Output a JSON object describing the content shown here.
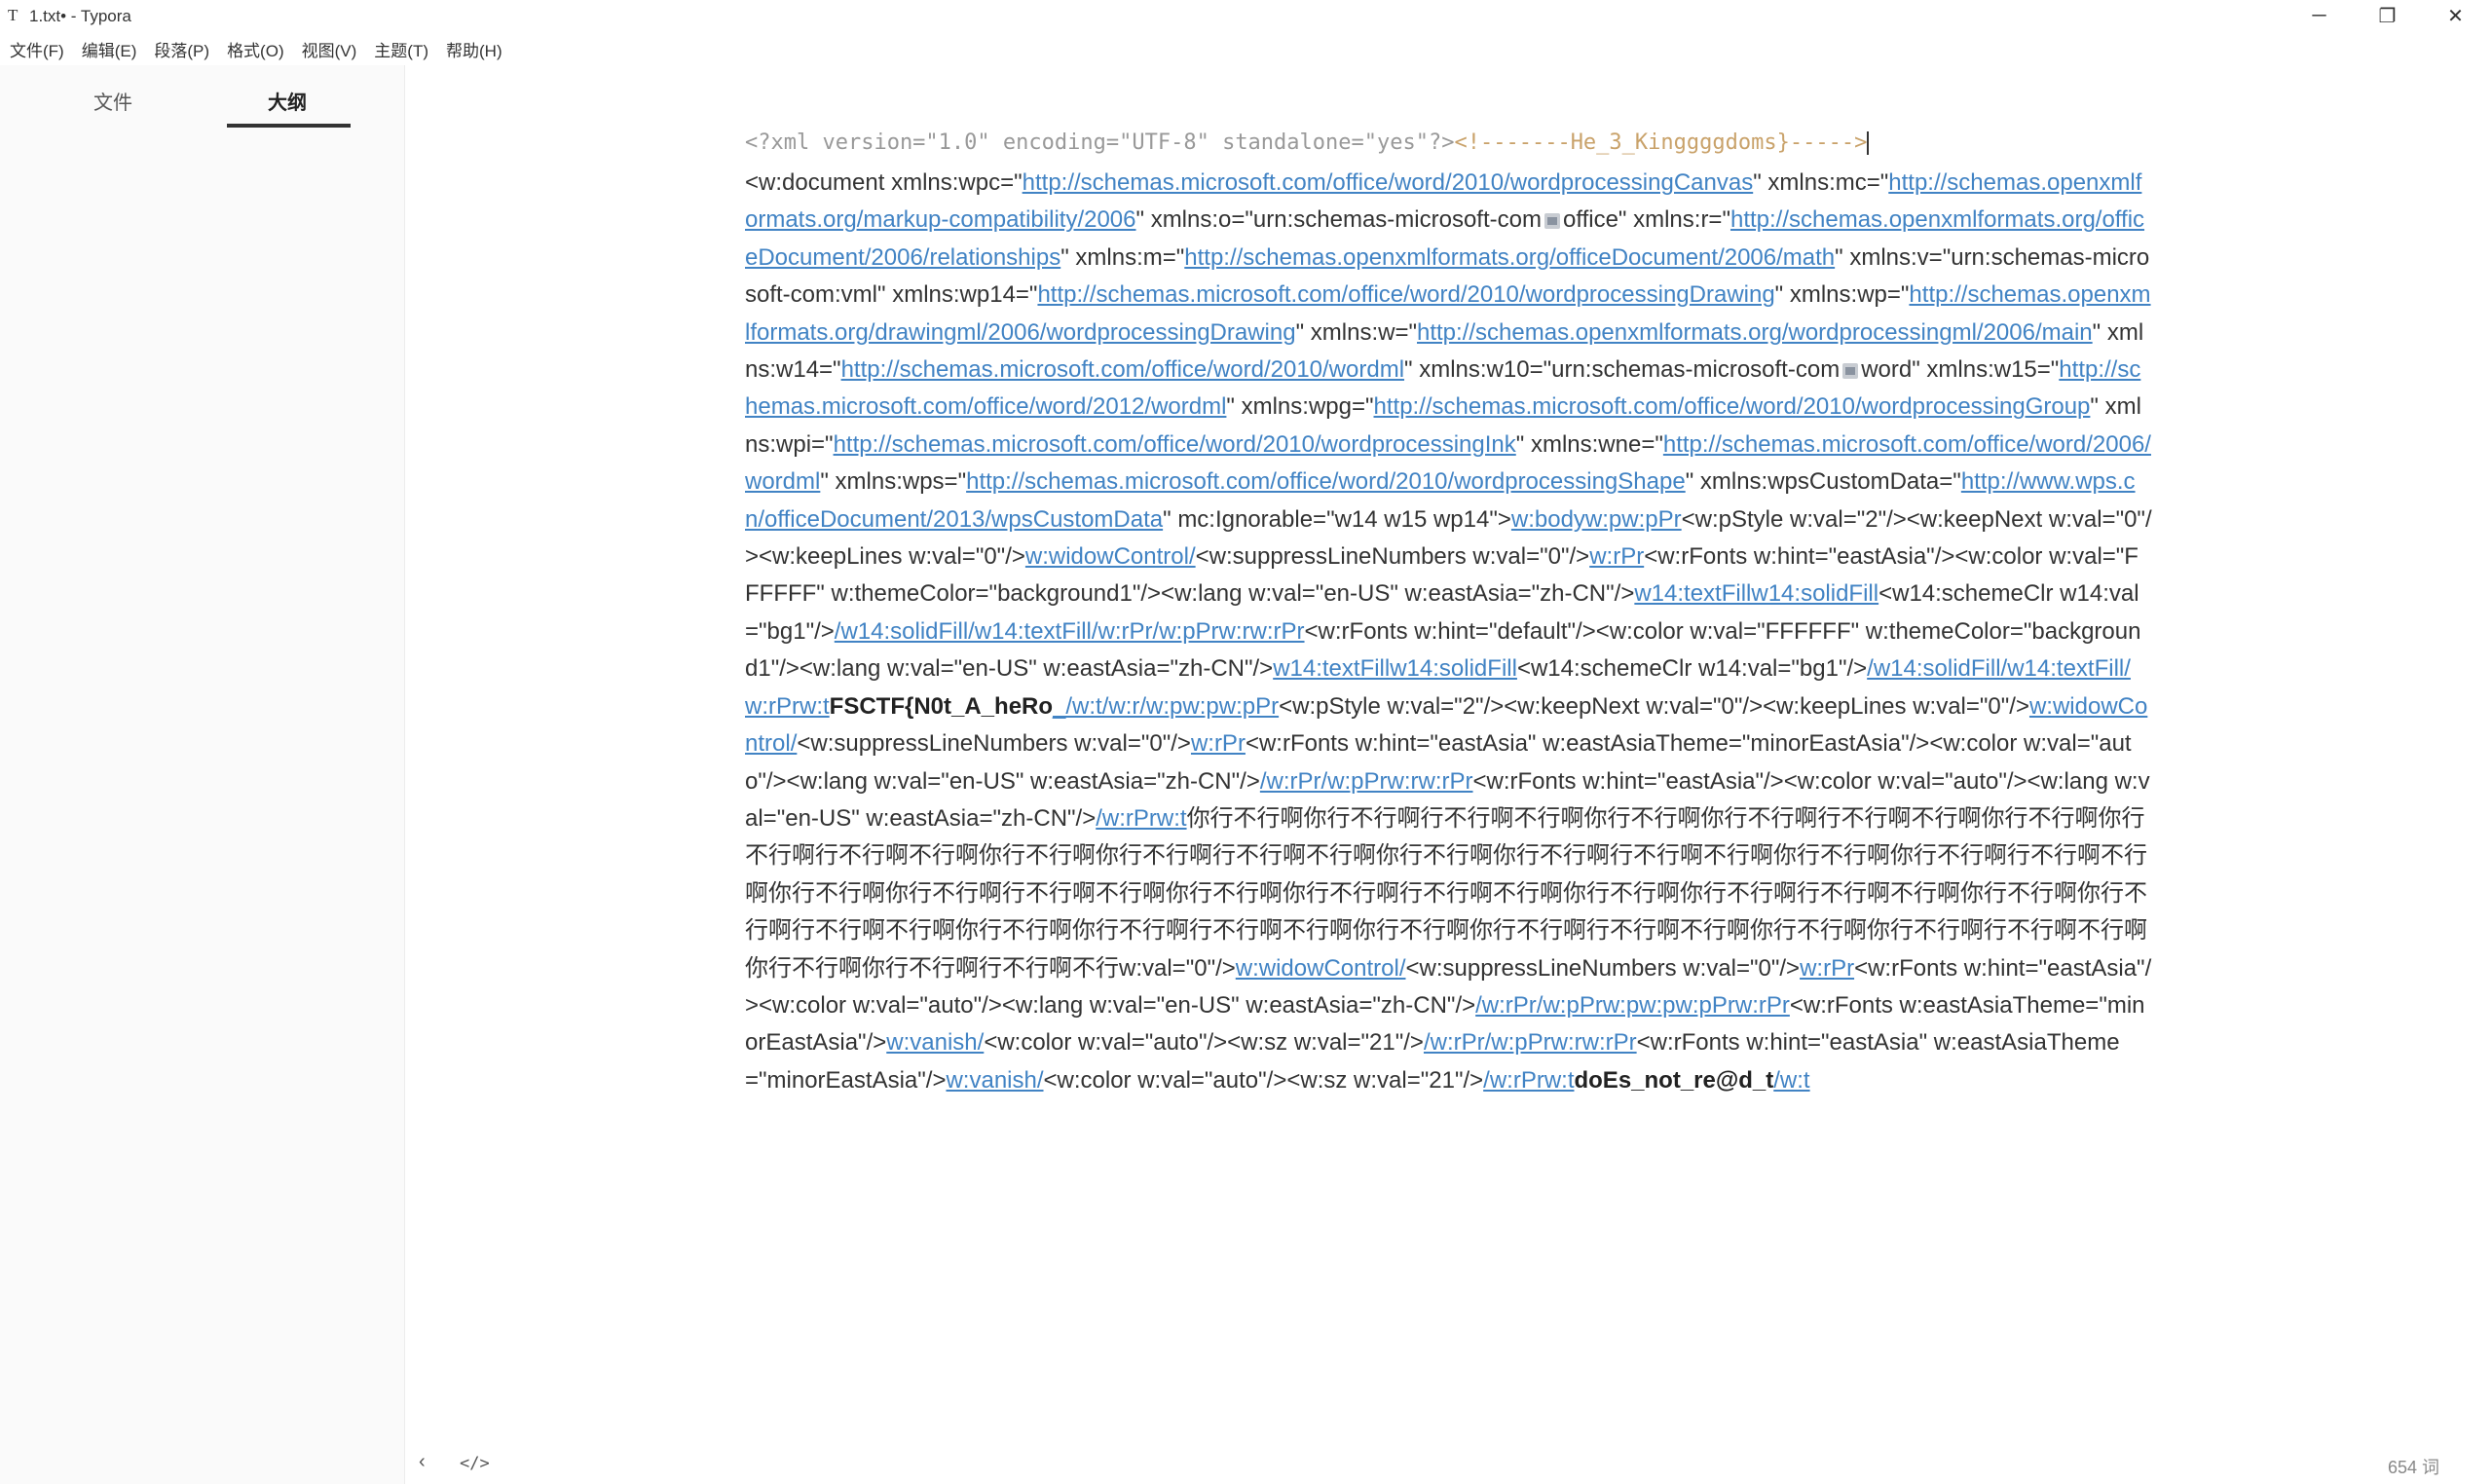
{
  "window": {
    "app_icon": "T",
    "title": "1.txt• - Typora",
    "minimize": "─",
    "maximize": "❐",
    "close": "✕"
  },
  "menu": [
    "文件(F)",
    "编辑(E)",
    "段落(P)",
    "格式(O)",
    "视图(V)",
    "主题(T)",
    "帮助(H)"
  ],
  "sidebar": {
    "tab_files": "文件",
    "tab_outline": "大纲"
  },
  "editor": {
    "code_line_1": "<?xml version=\"1.0\" encoding=\"UTF-8\" standalone=\"yes\"?>",
    "code_line_comment": "<!-------He_3_Kinggggdoms}----->",
    "seg": [
      "<w:document xmlns:wpc=\"",
      "http://schemas.microsoft.com/office/word/2010/wordprocessingCanvas",
      "\" xmlns:mc=\"",
      "http://schemas.openxmlformats.org/markup-compatibility/2006",
      "\" xmlns:o=\"urn:schemas-microsoft-com",
      "office\" xmlns:r=\"",
      "http://schemas.openxmlformats.org/officeDocument/2006/relationships",
      "\" xmlns:m=\"",
      "http://schemas.openxmlformats.org/officeDocument/2006/math",
      "\" xmlns:v=\"urn:schemas-microsoft-com:vml\" xmlns:wp14=\"",
      "http://schemas.microsoft.com/office/word/2010/wordprocessingDrawing",
      "\" xmlns:wp=\"",
      "http://schemas.openxmlformats.org/drawingml/2006/wordprocessingDrawing",
      "\" xmlns:w=\"",
      "http://schemas.openxmlformats.org/wordprocessingml/2006/main",
      "\" xmlns:w14=\"",
      "http://schemas.microsoft.com/office/word/2010/wordml",
      "\" xmlns:w10=\"urn:schemas-microsoft-com",
      "word\" xmlns:w15=\"",
      "http://schemas.microsoft.com/office/word/2012/wordml",
      "\" xmlns:wpg=\"",
      "http://schemas.microsoft.com/office/word/2010/wordprocessingGroup",
      "\" xmlns:wpi=\"",
      "http://schemas.microsoft.com/office/word/2010/wordprocessingInk",
      "\" xmlns:wne=\"",
      "http://schemas.microsoft.com/office/word/2006/wordml",
      "\" xmlns:wps=\"",
      "http://schemas.microsoft.com/office/word/2010/wordprocessingShape",
      "\" xmlns:wpsCustomData=\"",
      "http://www.wps.cn/officeDocument/2013/wpsCustomData",
      "\" mc:Ignorable=\"w14 w15 wp14\">",
      "w:bodyw:pw:pPr",
      "<w:pStyle w:val=\"2\"/><w:keepNext w:val=\"0\"/><w:keepLines w:val=\"0\"/>",
      "w:widowControl/",
      "<w:suppressLineNumbers w:val=\"0\"/>",
      "w:rPr",
      "<w:rFonts w:hint=\"eastAsia\"/><w:color w:val=\"FFFFFF\" w:themeColor=\"background1\"/><w:lang w:val=\"en-US\" w:eastAsia=\"zh-CN\"/>",
      "w14:textFillw14:solidFill",
      "<w14:schemeClr w14:val=\"bg1\"/>",
      "/w14:solidFill/w14:textFill/w:rPr/w:pPrw:rw:rPr",
      "<w:rFonts w:hint=\"default\"/><w:color w:val=\"FFFFFF\" w:themeColor=\"background1\"/><w:lang w:val=\"en-US\" w:eastAsia=\"zh-CN\"/>",
      "w14:textFillw14:solidFill",
      "<w14:schemeClr w14:val=\"bg1\"/>",
      "/w14:solidFill/w14:textFill/w:rPrw:t",
      "FSCTF{N0t_A_heRo",
      "_/w:t/w:r/w:pw:pw:pPr",
      "<w:pStyle w:val=\"2\"/><w:keepNext w:val=\"0\"/><w:keepLines w:val=\"0\"/>",
      "w:widowControl/",
      "<w:suppressLineNumbers w:val=\"0\"/>",
      "w:rPr",
      "<w:rFonts w:hint=\"eastAsia\" w:eastAsiaTheme=\"minorEastAsia\"/><w:color w:val=\"auto\"/><w:lang w:val=\"en-US\" w:eastAsia=\"zh-CN\"/>",
      "/w:rPr/w:pPrw:rw:rPr",
      "<w:rFonts w:hint=\"eastAsia\"/><w:color w:val=\"auto\"/><w:lang w:val=\"en-US\" w:eastAsia=\"zh-CN\"/>",
      "/w:rPrw:t",
      "你行不行啊你行不行啊行不行啊不行啊你行不行啊你行不行啊行不行啊不行啊你行不行啊你行不行啊行不行啊不行啊你行不行啊你行不行啊行不行啊不行啊你行不行啊你行不行啊行不行啊不行啊你行不行啊你行不行啊行不行啊不行啊你行不行啊你行不行啊行不行啊不行啊你行不行啊你行不行啊行不行啊不行啊你行不行啊你行不行啊行不行啊不行啊你行不行啊你行不行啊行不行啊不行啊你行不行啊你行不行啊行不行啊不行啊你行不行啊你行不行啊行不行啊不行啊你行不行啊你行不行啊行不行啊不行啊你行不行啊你行不行啊行不行啊不行",
      "w:val=\"0\"/>",
      "w:widowControl/",
      "<w:suppressLineNumbers w:val=\"0\"/>",
      "w:rPr",
      "<w:rFonts w:hint=\"eastAsia\"/><w:color w:val=\"auto\"/><w:lang w:val=\"en-US\" w:eastAsia=\"zh-CN\"/>",
      "/w:rPr/w:pPrw:pw:pw:pPrw:rPr",
      "<w:rFonts w:eastAsiaTheme=\"minorEastAsia\"/>",
      "w:vanish/",
      "<w:color w:val=\"auto\"/><w:sz w:val=\"21\"/>",
      "/w:rPr/w:pPrw:rw:rPr",
      "<w:rFonts w:hint=\"eastAsia\" w:eastAsiaTheme=\"minorEastAsia\"/>",
      "w:vanish/",
      "<w:color w:val=\"auto\"/><w:sz w:val=\"21\"/>",
      "/w:rPrw:t",
      "doEs_not_re@d_t",
      "/w:t"
    ]
  },
  "status": {
    "back": "‹",
    "source_toggle": "</>",
    "word_count": "654 词"
  }
}
